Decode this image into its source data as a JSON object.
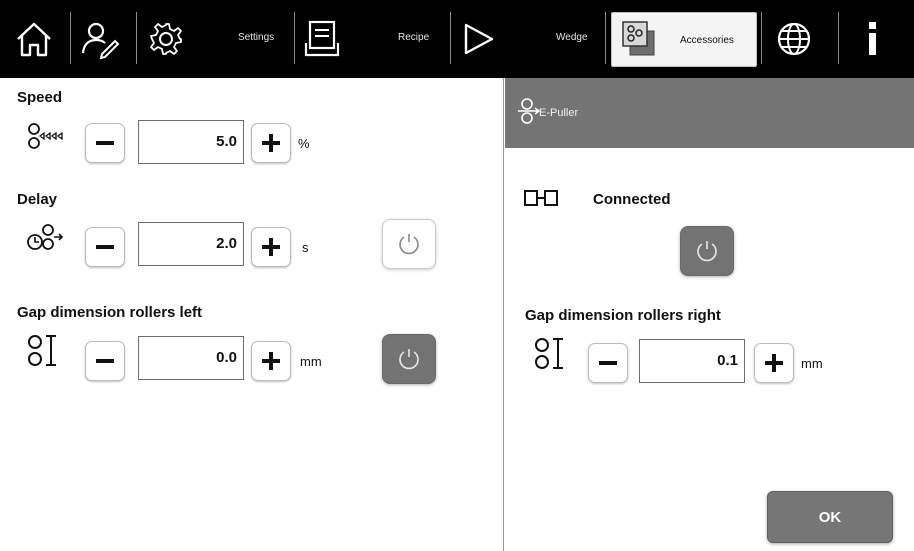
{
  "toolbar": {
    "settings_label": "Settings",
    "recipe_label": "Recipe",
    "wedge_label": "Wedge",
    "accessories_label": "Accessories",
    "active_tab": "Accessories",
    "icons": [
      "home-icon",
      "user-edit-icon",
      "gear-icon",
      "recipe-icon",
      "play-icon",
      "accessories-icon",
      "globe-icon",
      "info-icon"
    ]
  },
  "left": {
    "speed": {
      "title": "Speed",
      "value": "5.0",
      "unit": "%"
    },
    "delay": {
      "title": "Delay",
      "value": "2.0",
      "unit": "s",
      "power_state": "off"
    },
    "gap_left": {
      "title": "Gap dimension rollers left",
      "value": "0.0",
      "unit": "mm",
      "power_state": "on"
    }
  },
  "right": {
    "header_title": "E-Puller",
    "status": "Connected",
    "power_state": "on",
    "gap_right": {
      "title": "Gap dimension rollers right",
      "value": "0.1",
      "unit": "mm"
    },
    "ok_label": "OK"
  },
  "colors": {
    "toolbar_bg": "#000000",
    "header_bg": "#747474",
    "active_button": "#737373",
    "ok_button": "#767676"
  }
}
